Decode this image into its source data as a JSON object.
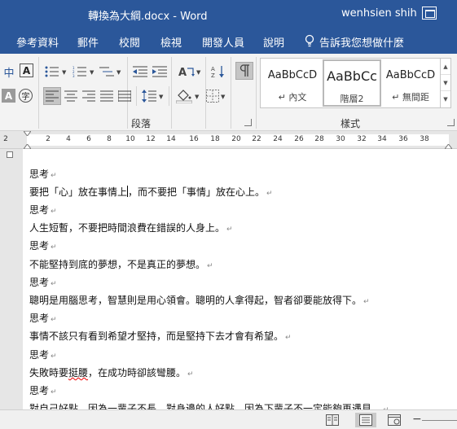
{
  "titlebar": {
    "document_title": "轉換為大綱.docx - Word",
    "user_name": "wenhsien shih",
    "restore_icon": "ribbon-display-options-icon"
  },
  "tabs": [
    {
      "label": "參考資料"
    },
    {
      "label": "郵件"
    },
    {
      "label": "校閱"
    },
    {
      "label": "檢視"
    },
    {
      "label": "開發人員"
    },
    {
      "label": "說明"
    }
  ],
  "tell_me": {
    "label": "告訴我您想做什麼",
    "icon": "lightbulb-icon"
  },
  "ribbon": {
    "paragraph_group_label": "段落",
    "styles_group_label": "樣式",
    "phonetic_guide": "中",
    "enclose_char": "字",
    "char_border": "A",
    "char_shading": "A",
    "styles": [
      {
        "preview": "AaBbCcD",
        "name": "↵ 內文"
      },
      {
        "preview": "AaBbCc",
        "name": "階層2"
      },
      {
        "preview": "AaBbCcD",
        "name": "↵ 無間距"
      }
    ]
  },
  "ruler": {
    "ticks": [
      "2",
      "2",
      "4",
      "6",
      "8",
      "10",
      "12",
      "14",
      "16",
      "18",
      "20",
      "22",
      "24",
      "26",
      "28",
      "30",
      "32",
      "34",
      "36",
      "38"
    ]
  },
  "document": {
    "lines": [
      {
        "text": "思考"
      },
      {
        "text_before": "要把「心」放在事情上",
        "text_after": "，而不要把「事情」放在心上。"
      },
      {
        "text": "思考"
      },
      {
        "text": "人生短暫，不要把時間浪費在錯誤的人身上。"
      },
      {
        "text": "思考"
      },
      {
        "text": "不能堅持到底的夢想，不是真正的夢想。"
      },
      {
        "text": "思考"
      },
      {
        "text": "聰明是用腦思考，智慧則是用心領會。聰明的人拿得起，智者卻要能放得下。"
      },
      {
        "text": "思考"
      },
      {
        "text": "事情不該只有看到希望才堅持，而是堅持下去才會有希望。"
      },
      {
        "text": "思考"
      },
      {
        "text_before": "失敗時要",
        "text_squiggle": "挺腰",
        "text_after": "，在成功時卻該彎腰。"
      },
      {
        "text": "思考"
      },
      {
        "text": "對自己好點，因為一輩子不長，對身邊的人好點，因為下輩子不一定能夠再遇見。"
      }
    ],
    "paragraph_mark": "↵"
  },
  "statusbar": {
    "zoom_minus": "−"
  }
}
